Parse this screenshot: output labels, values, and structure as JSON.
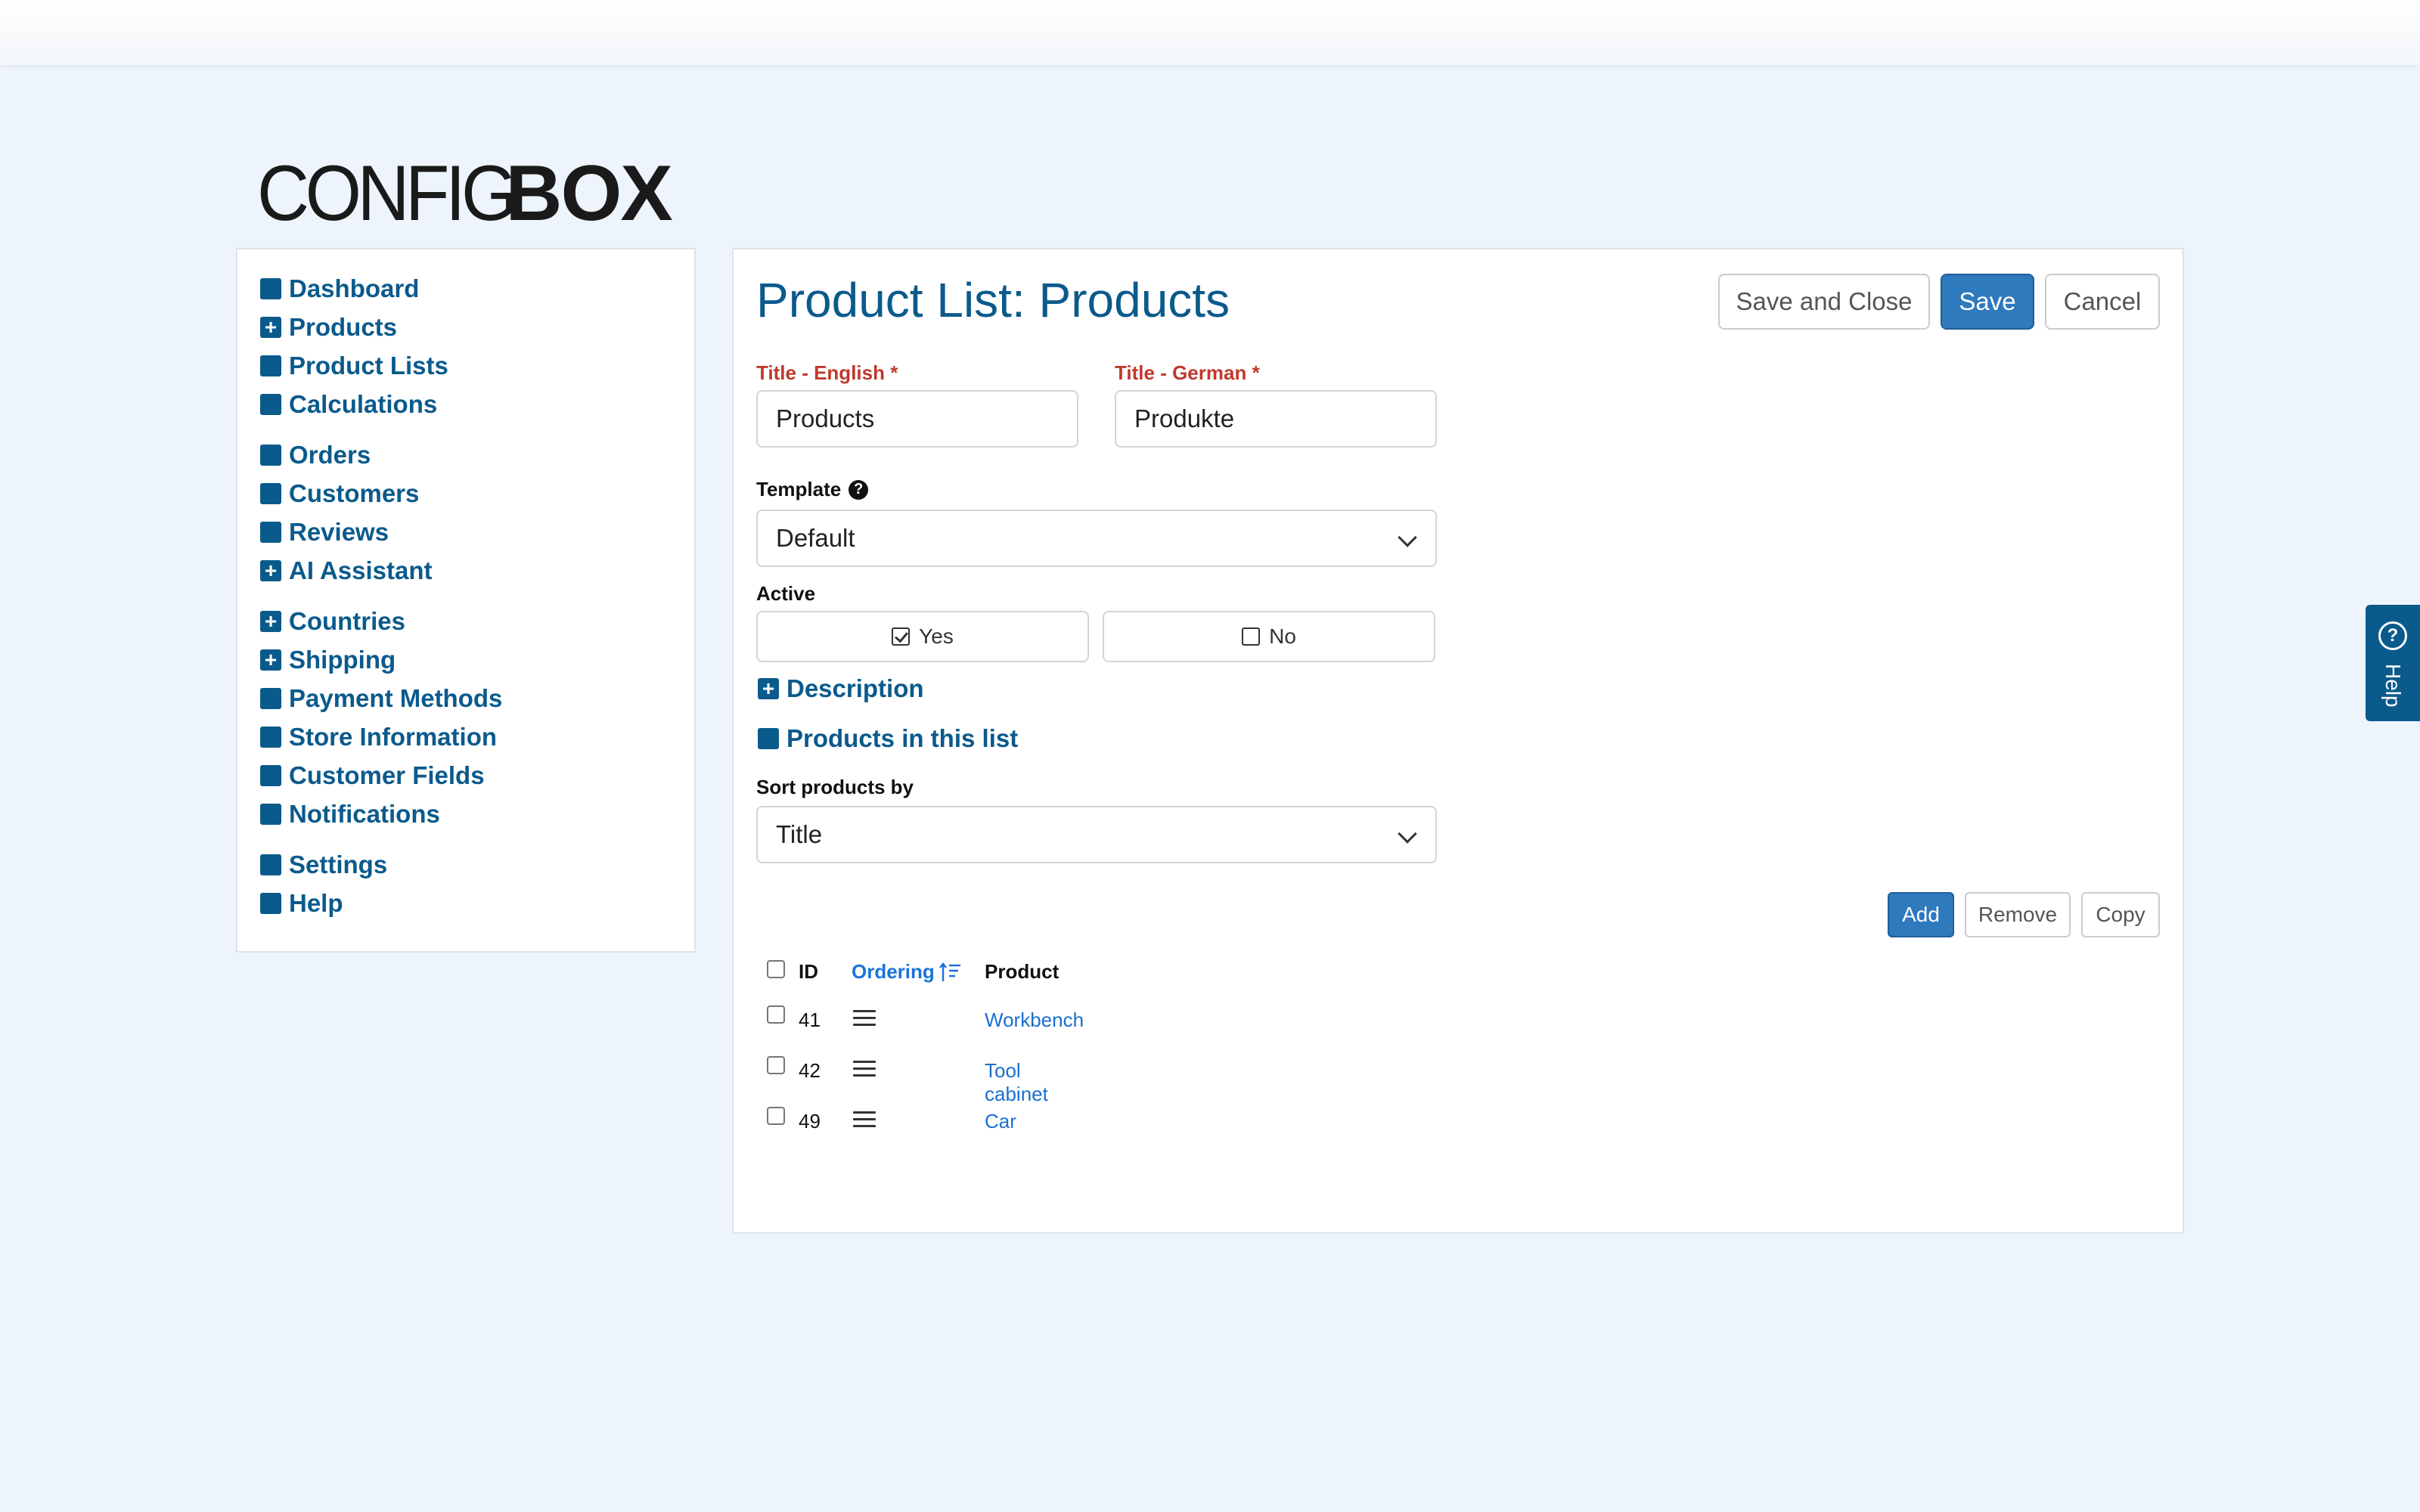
{
  "logo": {
    "light": "CONFIG",
    "bold": "BOX"
  },
  "sidebar": {
    "groups": [
      [
        {
          "label": "Dashboard",
          "icon": "square",
          "expandable": false
        },
        {
          "label": "Products",
          "icon": "plus",
          "expandable": true
        },
        {
          "label": "Product Lists",
          "icon": "square",
          "expandable": false
        },
        {
          "label": "Calculations",
          "icon": "square",
          "expandable": false
        }
      ],
      [
        {
          "label": "Orders",
          "icon": "square",
          "expandable": false
        },
        {
          "label": "Customers",
          "icon": "square",
          "expandable": false
        },
        {
          "label": "Reviews",
          "icon": "square",
          "expandable": false
        },
        {
          "label": "AI Assistant",
          "icon": "plus",
          "expandable": true
        }
      ],
      [
        {
          "label": "Countries",
          "icon": "plus",
          "expandable": true
        },
        {
          "label": "Shipping",
          "icon": "plus",
          "expandable": true
        },
        {
          "label": "Payment Methods",
          "icon": "square",
          "expandable": false
        },
        {
          "label": "Store Information",
          "icon": "square",
          "expandable": false
        },
        {
          "label": "Customer Fields",
          "icon": "square",
          "expandable": false
        },
        {
          "label": "Notifications",
          "icon": "square",
          "expandable": false
        }
      ],
      [
        {
          "label": "Settings",
          "icon": "square",
          "expandable": false
        },
        {
          "label": "Help",
          "icon": "square",
          "expandable": false
        }
      ]
    ]
  },
  "main": {
    "title": "Product List: Products",
    "buttons": {
      "save_close": "Save and Close",
      "save": "Save",
      "cancel": "Cancel"
    },
    "title_en": {
      "label": "Title - English *",
      "value": "Products"
    },
    "title_de": {
      "label": "Title - German *",
      "value": "Produkte"
    },
    "template": {
      "label": "Template",
      "value": "Default",
      "help_glyph": "?"
    },
    "active": {
      "label": "Active",
      "yes": "Yes",
      "no": "No",
      "selected": "Yes"
    },
    "description_section": "Description",
    "products_section": "Products in this list",
    "sort": {
      "label": "Sort products by",
      "value": "Title"
    },
    "list_buttons": {
      "add": "Add",
      "remove": "Remove",
      "copy": "Copy"
    },
    "table": {
      "headers": {
        "id": "ID",
        "ordering": "Ordering",
        "product": "Product"
      },
      "rows": [
        {
          "id": "41",
          "product": "Workbench"
        },
        {
          "id": "42",
          "product": "Tool cabinet"
        },
        {
          "id": "49",
          "product": "Car"
        }
      ]
    }
  },
  "help_tab": {
    "label": "Help",
    "glyph": "?"
  },
  "colors": {
    "brand": "#0b5a8c",
    "primary": "#2f79bd",
    "required": "#c0392b",
    "link": "#1a6fd0",
    "background": "#eef4fc"
  }
}
